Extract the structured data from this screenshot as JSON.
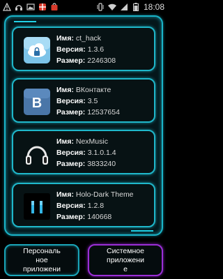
{
  "status_bar": {
    "time": "18:08",
    "left_icons": [
      "warning-icon",
      "headphones-icon",
      "image-icon",
      "gift-icon",
      "bag-icon"
    ],
    "right_icons": [
      "vibrate-icon",
      "wifi-icon",
      "signal-icon",
      "battery-icon"
    ]
  },
  "labels": {
    "name": "Имя:",
    "version": "Версия:",
    "size": "Размер:"
  },
  "apps": [
    {
      "icon": "cloud-lock-icon",
      "name": "ct_hack",
      "version": "1.3.6",
      "size": "2246308"
    },
    {
      "icon": "vk-icon",
      "name": "ВКонтакте",
      "version": "3.5",
      "size": "12537654"
    },
    {
      "icon": "headphones-icon",
      "name": "NexMusic",
      "version": "3.1.0.1.4",
      "size": "3833240"
    },
    {
      "icon": "holo-theme-icon",
      "name": "Holo-Dark Theme",
      "version": "1.2.8",
      "size": "140668"
    }
  ],
  "bottom": {
    "personal_line1": "Персональ",
    "personal_line2": "ное",
    "personal_line3": "приложени",
    "system_line1": "Системное",
    "system_line2": "приложени",
    "system_line3": "е"
  },
  "colors": {
    "accent": "#1ab4c8",
    "active_border": "#9b2fd6"
  }
}
